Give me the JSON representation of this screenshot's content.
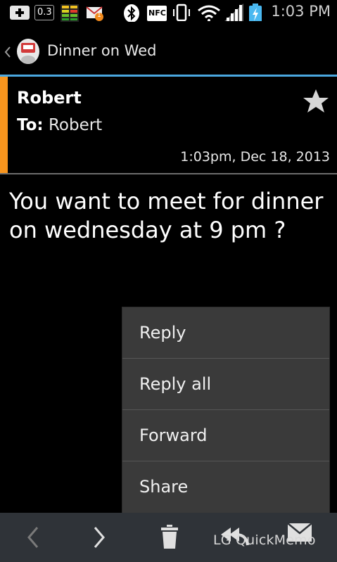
{
  "status_bar": {
    "data_speed": "0.3",
    "time": "1:03 PM",
    "nfc_label": "NFC",
    "notification_badge": "1"
  },
  "action_bar": {
    "title": "Dinner on Wed"
  },
  "message": {
    "sender": "Robert",
    "to_label": "To:",
    "to_value": "Robert",
    "timestamp": "1:03pm, Dec 18, 2013",
    "body": "You want to meet for dinner on wednesday at 9 pm ?"
  },
  "menu": {
    "items": [
      {
        "label": "Reply"
      },
      {
        "label": "Reply all"
      },
      {
        "label": "Forward"
      },
      {
        "label": "Share"
      }
    ]
  },
  "toolbar": {
    "overlay_text": "LG QuickMemo"
  },
  "colors": {
    "accent_orange": "#f7941d",
    "accent_blue": "#4aa7df",
    "menu_bg": "#3a3a3a",
    "toolbar_bg": "#2f3338"
  }
}
